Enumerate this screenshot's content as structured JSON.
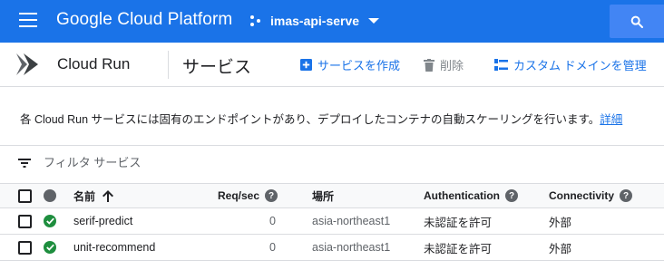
{
  "topbar": {
    "brand": "Google Cloud Platform",
    "project_name": "imas-api-serve",
    "menu_icon": "hamburger-menu-icon",
    "search_icon": "search-icon",
    "color": "#1a73e8"
  },
  "subheader": {
    "product": "Cloud Run",
    "page_title": "サービス",
    "actions": {
      "create": "サービスを作成",
      "delete": "削除",
      "domain": "カスタム ドメインを管理"
    }
  },
  "info": {
    "text": "各 Cloud Run サービスには固有のエンドポイントがあり、デプロイしたコンテナの自動スケーリングを行います。",
    "link": "詳細"
  },
  "filter": {
    "placeholder": "フィルタ サービス",
    "value": ""
  },
  "table": {
    "headers": {
      "name": "名前",
      "requests": "Req/sec",
      "location": "場所",
      "auth": "Authentication",
      "connectivity": "Connectivity"
    },
    "rows": [
      {
        "name": "serif-predict",
        "requests": "0",
        "location": "asia-northeast1",
        "auth": "未認証を許可",
        "connectivity": "外部",
        "status": "ok"
      },
      {
        "name": "unit-recommend",
        "requests": "0",
        "location": "asia-northeast1",
        "auth": "未認証を許可",
        "connectivity": "外部",
        "status": "ok"
      }
    ]
  },
  "colors": {
    "accent": "#1a73e8",
    "ok": "#1e8e3e"
  }
}
